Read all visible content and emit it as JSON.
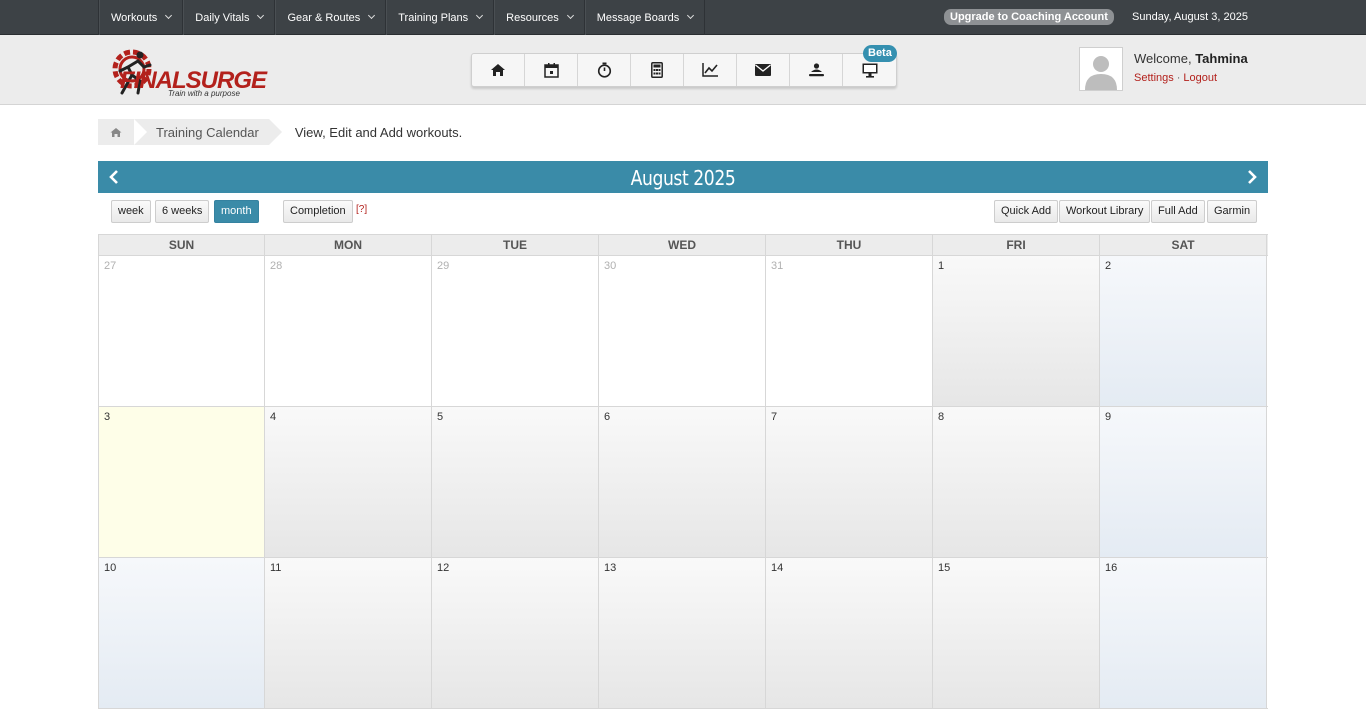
{
  "topnav": {
    "menu": [
      "Workouts",
      "Daily Vitals",
      "Gear & Routes",
      "Training Plans",
      "Resources",
      "Message Boards"
    ],
    "upgrade_label": "Upgrade to Coaching Account",
    "date": "Sunday, August 3, 2025"
  },
  "header": {
    "logo_text": "FINALSURGE",
    "logo_tagline": "Train with a purpose",
    "icons": [
      "home-icon",
      "calendar-icon",
      "stopwatch-icon",
      "calculator-icon",
      "chart-line-icon",
      "mail-icon",
      "rowing-icon",
      "monitor-icon"
    ],
    "beta_label": "Beta",
    "welcome_prefix": "Welcome,",
    "user_name": "Tahmina",
    "settings_label": "Settings",
    "logout_label": "Logout"
  },
  "breadcrumb": {
    "current": "Training Calendar",
    "description": "View, Edit and Add workouts."
  },
  "calendar": {
    "title": "August 2025",
    "view_buttons": [
      "week",
      "6 weeks",
      "month"
    ],
    "active_view": "month",
    "completion_label": "Completion",
    "help_label": "[?]",
    "actions": [
      "Quick Add",
      "Workout Library",
      "Full Add",
      "Garmin"
    ],
    "days_of_week": [
      "SUN",
      "MON",
      "TUE",
      "WED",
      "THU",
      "FRI",
      "SAT"
    ],
    "weeks": [
      [
        {
          "n": "27",
          "t": "other"
        },
        {
          "n": "28",
          "t": "other"
        },
        {
          "n": "29",
          "t": "other"
        },
        {
          "n": "30",
          "t": "other"
        },
        {
          "n": "31",
          "t": "other"
        },
        {
          "n": "1",
          "t": "norm"
        },
        {
          "n": "2",
          "t": "weekend"
        }
      ],
      [
        {
          "n": "3",
          "t": "today"
        },
        {
          "n": "4",
          "t": "norm"
        },
        {
          "n": "5",
          "t": "norm"
        },
        {
          "n": "6",
          "t": "norm"
        },
        {
          "n": "7",
          "t": "norm"
        },
        {
          "n": "8",
          "t": "norm"
        },
        {
          "n": "9",
          "t": "weekend"
        }
      ],
      [
        {
          "n": "10",
          "t": "weekend"
        },
        {
          "n": "11",
          "t": "norm"
        },
        {
          "n": "12",
          "t": "norm"
        },
        {
          "n": "13",
          "t": "norm"
        },
        {
          "n": "14",
          "t": "norm"
        },
        {
          "n": "15",
          "t": "norm"
        },
        {
          "n": "16",
          "t": "weekend"
        }
      ]
    ]
  },
  "colors": {
    "accent": "#3a8ba8",
    "brand_red": "#b3211c",
    "nav_bg": "#3d4246"
  }
}
